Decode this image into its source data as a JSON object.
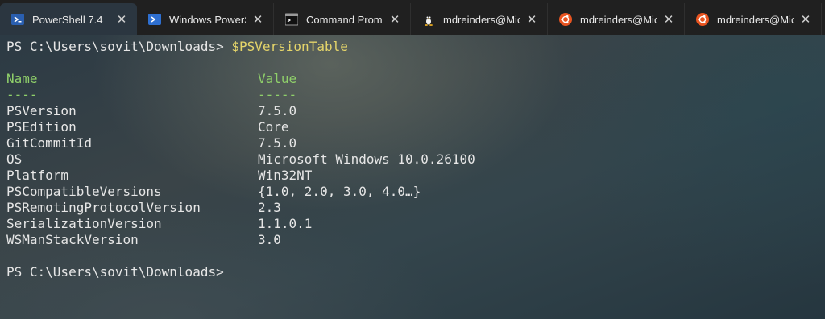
{
  "tabs": [
    {
      "label": "PowerShell 7.4",
      "icon": "powershell-icon",
      "active": true
    },
    {
      "label": "Windows PowerS",
      "icon": "powershell-icon",
      "active": false
    },
    {
      "label": "Command Promp",
      "icon": "cmd-icon",
      "active": false
    },
    {
      "label": "mdreinders@Mic",
      "icon": "linux-icon",
      "active": false
    },
    {
      "label": "mdreinders@Mic",
      "icon": "ubuntu-icon",
      "active": false
    },
    {
      "label": "mdreinders@Mic",
      "icon": "ubuntu-icon",
      "active": false
    }
  ],
  "close_glyph": "✕",
  "terminal": {
    "prompt1": "PS C:\\Users\\sovit\\Downloads> ",
    "command1": "$PSVersionTable",
    "header_name": "Name",
    "header_value": "Value",
    "underline_name": "----",
    "underline_value": "-----",
    "rows": [
      {
        "name": "PSVersion",
        "value": "7.5.0"
      },
      {
        "name": "PSEdition",
        "value": "Core"
      },
      {
        "name": "GitCommitId",
        "value": "7.5.0"
      },
      {
        "name": "OS",
        "value": "Microsoft Windows 10.0.26100"
      },
      {
        "name": "Platform",
        "value": "Win32NT"
      },
      {
        "name": "PSCompatibleVersions",
        "value": "{1.0, 2.0, 3.0, 4.0…}"
      },
      {
        "name": "PSRemotingProtocolVersion",
        "value": "2.3"
      },
      {
        "name": "SerializationVersion",
        "value": "1.1.0.1"
      },
      {
        "name": "WSManStackVersion",
        "value": "3.0"
      }
    ],
    "prompt2": "PS C:\\Users\\sovit\\Downloads>"
  },
  "colors": {
    "command": "#e5d56a",
    "header": "#8fcf6a",
    "text": "#e6e6e6",
    "tabbar": "#202020",
    "active_tab": "#2b3640"
  }
}
